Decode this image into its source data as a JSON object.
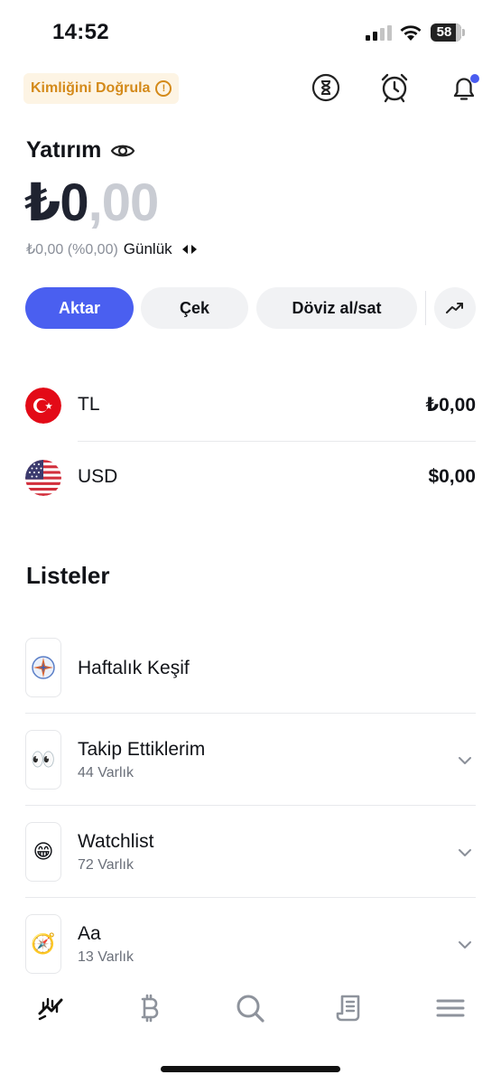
{
  "status_bar": {
    "time": "14:52",
    "battery_level": "58"
  },
  "header": {
    "verify_label": "Kimliğini Doğrula",
    "verify_info_glyph": "!",
    "icons": [
      "hourglass-icon",
      "alarm-clock-icon",
      "bell-icon"
    ],
    "notification_dot_color": "#4a5cf0"
  },
  "investment": {
    "title": "Yatırım",
    "balance_main": "₺0",
    "balance_decimals": ",00",
    "daily_change": "₺0,00 (%0,00)",
    "period": "Günlük"
  },
  "actions": {
    "transfer": "Aktar",
    "withdraw": "Çek",
    "fx": "Döviz al/sat",
    "accent_color": "#4a5ff0"
  },
  "currencies": [
    {
      "name": "TL",
      "amount": "₺0,00",
      "flag": "turkey-flag-icon"
    },
    {
      "name": "USD",
      "amount": "$0,00",
      "flag": "usa-flag-icon"
    }
  ],
  "lists": {
    "title": "Listeler",
    "items": [
      {
        "name": "Haftalık Keşif",
        "count": "",
        "icon": "compass-rose-icon",
        "glyph": ""
      },
      {
        "name": "Takip Ettiklerim",
        "count": "44 Varlık",
        "icon": "eyes-emoji-icon",
        "glyph": "👀"
      },
      {
        "name": "Watchlist",
        "count": "72 Varlık",
        "icon": "grinning-face-emoji-icon",
        "glyph": "😁"
      },
      {
        "name": "Aa",
        "count": "13 Varlık",
        "icon": "compass-emoji-icon",
        "glyph": "🧭"
      }
    ]
  },
  "tab_bar": {
    "tabs": [
      "portfolio-chart-icon",
      "bitcoin-icon",
      "search-icon",
      "document-icon",
      "menu-icon"
    ]
  }
}
